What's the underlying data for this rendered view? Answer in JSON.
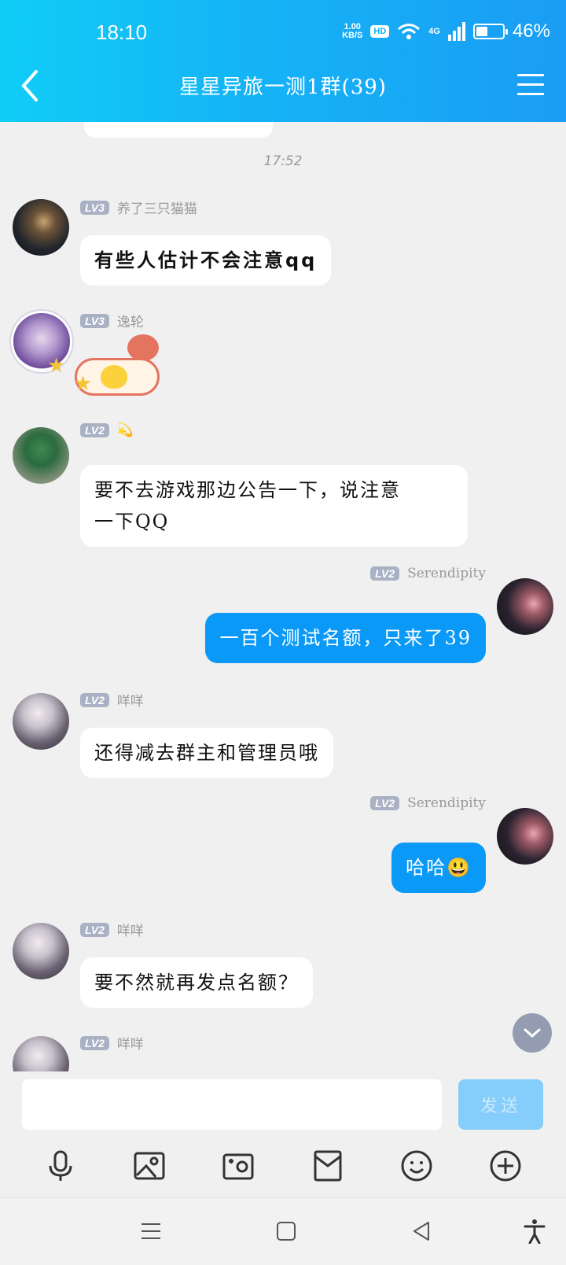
{
  "status_bar": {
    "time": "18:10",
    "net_speed_value": "1.00",
    "net_speed_unit": "KB/S",
    "hd": "HD",
    "network": "4G",
    "battery": "46%",
    "battery_level": 0.46
  },
  "header": {
    "title": "星星异旅一测1群(39)",
    "back_icon": "chevron-left-icon",
    "menu_icon": "menu-icon"
  },
  "chat": {
    "time_separator": "17:52",
    "messages": [
      {
        "level": "LV3",
        "nickname": "养了三只猫猫",
        "text": "有些人估计不会注意qq",
        "outgoing": false
      },
      {
        "level": "LV3",
        "nickname": "逸轮",
        "sticker": "cartoon-sticker",
        "outgoing": false
      },
      {
        "level": "LV2",
        "nickname": "💫",
        "text": "要不去游戏那边公告一下，说注意一下QQ",
        "line1": "要不去游戏那边公告一下，说注意",
        "line2": "一下QQ",
        "outgoing": false
      },
      {
        "level": "LV2",
        "nickname": "Serendipity",
        "text": "一百个测试名额，只来了39",
        "outgoing": true
      },
      {
        "level": "LV2",
        "nickname": "咩咩",
        "text": "还得减去群主和管理员哦",
        "outgoing": false
      },
      {
        "level": "LV2",
        "nickname": "Serendipity",
        "text": "哈哈😃",
        "outgoing": true
      },
      {
        "level": "LV2",
        "nickname": "咩咩",
        "text": "要不然就再发点名额？",
        "outgoing": false
      },
      {
        "level": "LV2",
        "nickname": "咩咩",
        "outgoing": false
      }
    ]
  },
  "input": {
    "value": "",
    "send_label": "发送"
  },
  "toolbar": {
    "items": [
      "mic-icon",
      "image-icon",
      "camera-icon",
      "red-packet-icon",
      "emoji-icon",
      "plus-icon"
    ]
  },
  "nav": {
    "items": [
      "recent-apps-icon",
      "home-icon",
      "back-icon",
      "accessibility-icon"
    ]
  }
}
